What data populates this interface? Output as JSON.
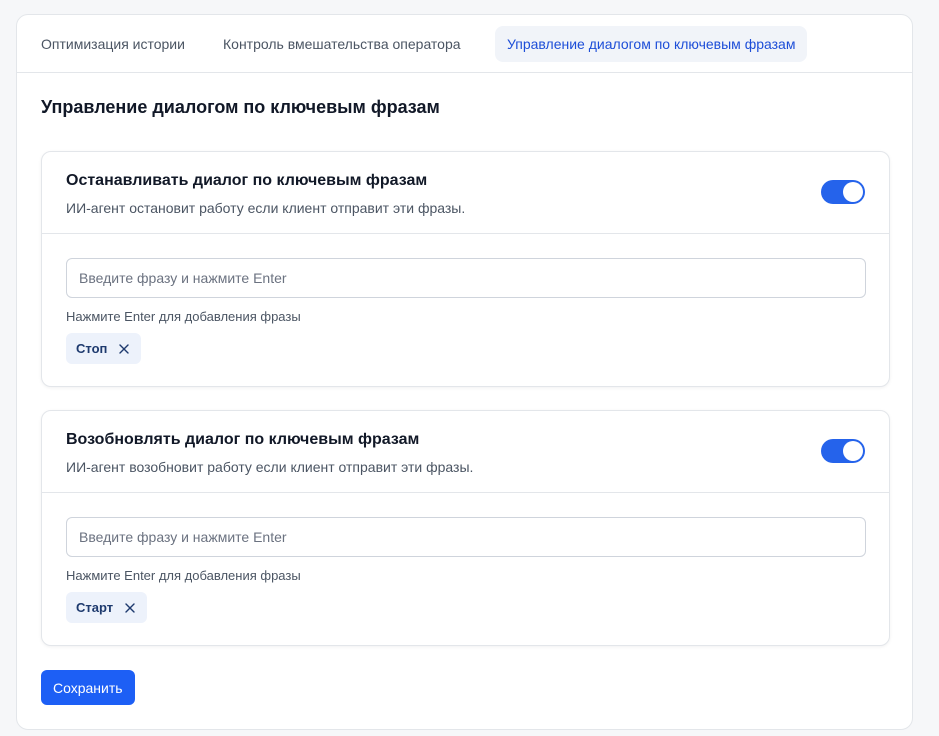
{
  "tabs": [
    {
      "label": "Оптимизация истории"
    },
    {
      "label": "Контроль вмешательства оператора"
    },
    {
      "label": "Управление диалогом по ключевым фразам"
    }
  ],
  "section": {
    "title": "Управление диалогом по ключевым фразам"
  },
  "cards": [
    {
      "title": "Останавливать диалог по ключевым фразам",
      "description": "ИИ-агент остановит работу если клиент отправит эти фразы.",
      "enabled": true,
      "input_placeholder": "Введите фразу и нажмите Enter",
      "input_value": "",
      "hint": "Нажмите Enter для добавления фразы",
      "chips": [
        "Стоп"
      ]
    },
    {
      "title": "Возобновлять диалог по ключевым фразам",
      "description": "ИИ-агент возобновит работу если клиент отправит эти фразы.",
      "enabled": true,
      "input_placeholder": "Введите фразу и нажмите Enter",
      "input_value": "",
      "hint": "Нажмите Enter для добавления фразы",
      "chips": [
        "Старт"
      ]
    }
  ],
  "save_label": "Сохранить",
  "icons": {
    "chip_remove": "close-icon"
  },
  "colors": {
    "accent": "#2563eb",
    "active_tab_bg": "#f1f4f9",
    "active_tab_text": "#1d4ed8",
    "chip_bg": "#edf2fb",
    "button": "#1d5ff5"
  }
}
